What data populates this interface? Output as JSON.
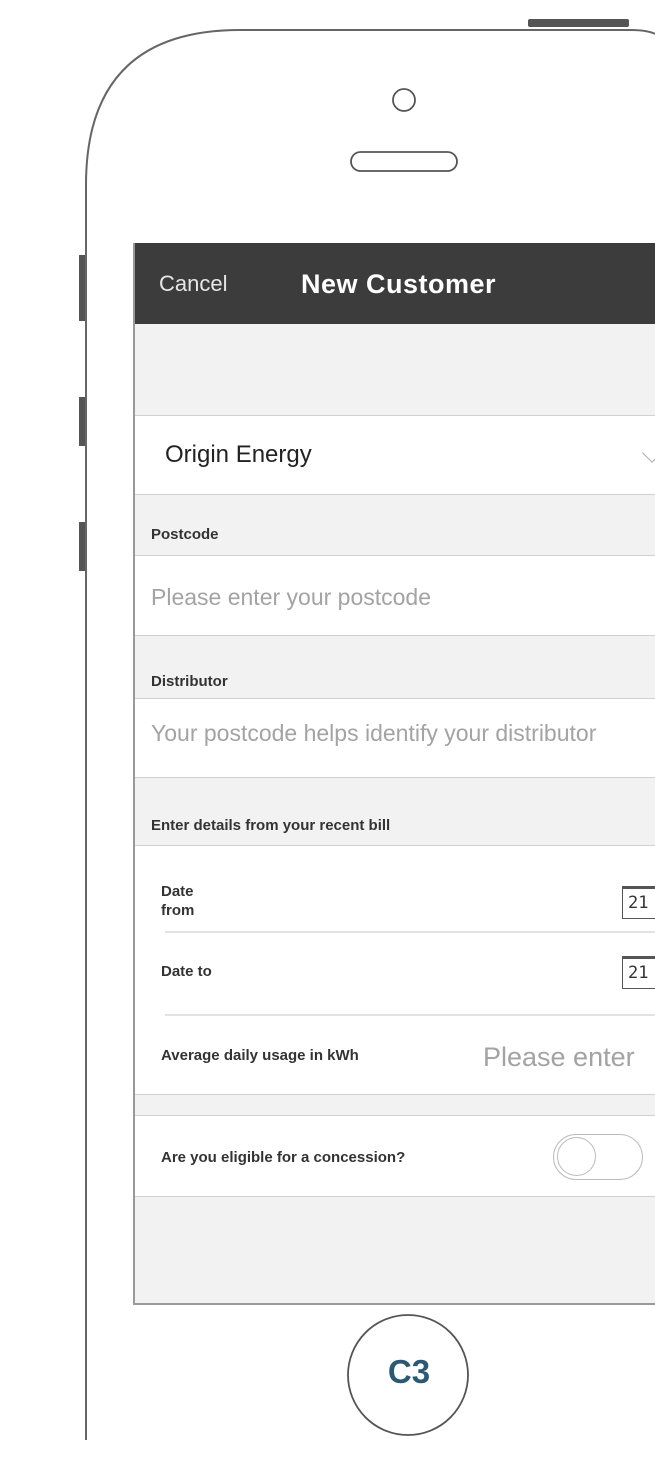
{
  "nav": {
    "cancel_label": "Cancel",
    "title": "New Customer"
  },
  "retailer": {
    "selected": "Origin Energy",
    "icon": "chevron-down-icon"
  },
  "postcode": {
    "label": "Postcode",
    "placeholder": "Please enter your postcode"
  },
  "distributor": {
    "label": "Distributor",
    "text": "Your postcode helps identify your distributor"
  },
  "bill": {
    "section_label": "Enter details from your recent bill",
    "date_from_label_line1": "Date",
    "date_from_label_line2": "from",
    "date_from_icon_day": "21",
    "date_to_label": "Date to",
    "date_to_icon_day": "21",
    "usage_label": "Average daily usage in kWh",
    "usage_placeholder": "Please enter"
  },
  "concession": {
    "label": "Are you eligible for a concession?",
    "toggle_on": false
  },
  "device": {
    "home_button_label": "C3"
  },
  "colors": {
    "navbar_bg": "#3c3c3c",
    "screen_bg": "#f2f2f2",
    "placeholder": "#a3a3a3",
    "home_label": "#2a5a73"
  }
}
